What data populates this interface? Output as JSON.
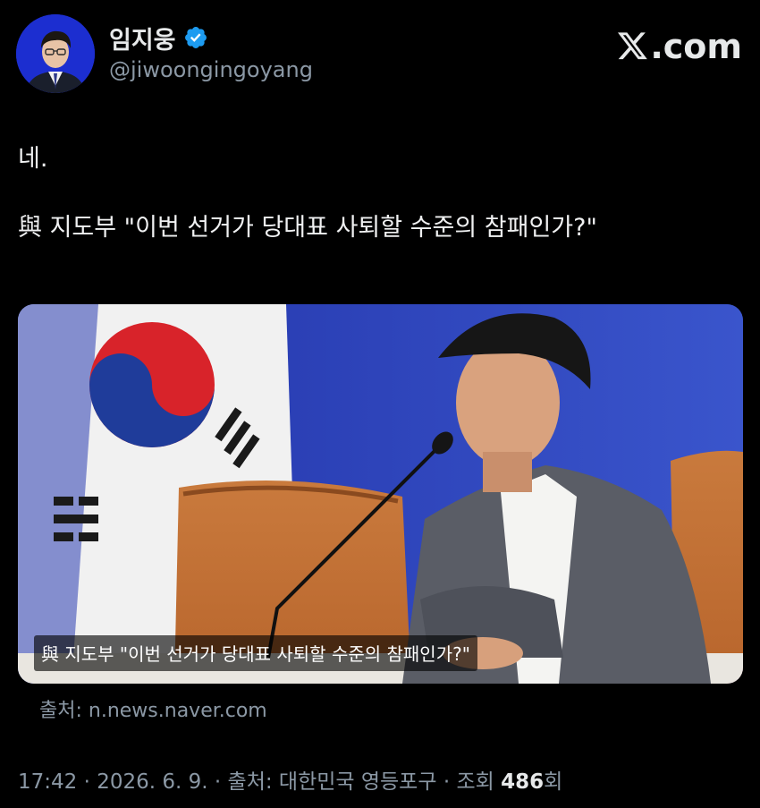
{
  "author": {
    "display_name": "임지웅",
    "handle": "@jiwoongingoyang",
    "verified": true,
    "avatar_icon": "profile-photo"
  },
  "brand": {
    "site": ".com",
    "logo_icon": "x-logo-icon"
  },
  "tweet": {
    "lines": [
      "네.",
      "與 지도부 \"이번 선거가 당대표 사퇴할 수준의 참패인가?\""
    ]
  },
  "media": {
    "caption": "與 지도부 \"이번 선거가 당대표 사퇴할 수준의 참패인가?\"",
    "source": "출처: n.news.naver.com"
  },
  "meta": {
    "time": "17:42",
    "date": "2026. 6. 9.",
    "location": "출처: 대한민국 영등포구",
    "views_label": "조회",
    "views_count": "486",
    "views_suffix": "회",
    "separator": " · "
  },
  "colors": {
    "background": "#000000",
    "text": "#e7e9ea",
    "muted": "#8b98a5",
    "verified": "#1d9bf0"
  }
}
